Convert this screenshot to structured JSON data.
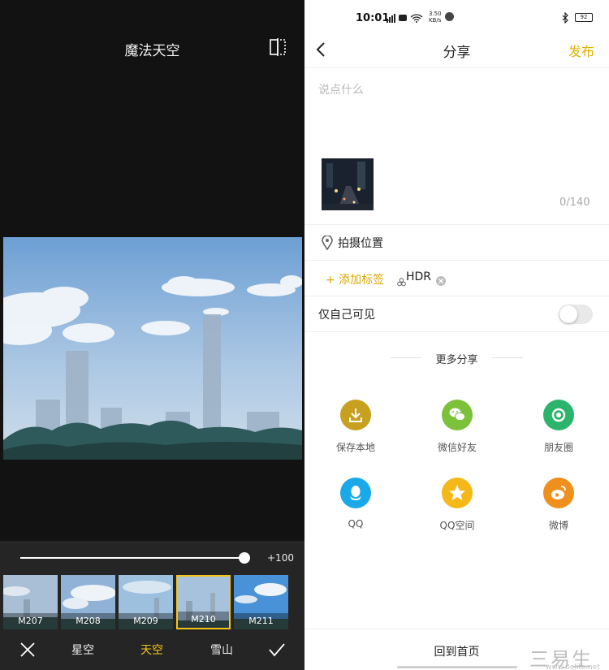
{
  "editor": {
    "title": "魔法天空",
    "slider": {
      "value": 1.0,
      "value_label": "+100"
    },
    "thumbnails": [
      {
        "label": "M207",
        "selected": false
      },
      {
        "label": "M208",
        "selected": false
      },
      {
        "label": "M209",
        "selected": false
      },
      {
        "label": "M210",
        "selected": true
      },
      {
        "label": "M211",
        "selected": false
      }
    ],
    "categories": [
      {
        "label": "星空",
        "active": false
      },
      {
        "label": "天空",
        "active": true
      },
      {
        "label": "雪山",
        "active": false
      }
    ],
    "accent_color": "#f5c518",
    "icons": {
      "compare": "compare-icon",
      "close": "close-icon",
      "confirm": "check-icon"
    }
  },
  "share": {
    "status": {
      "time": "10:01",
      "speed": "3.50",
      "speed_unit": "KB/s",
      "battery": "92"
    },
    "nav": {
      "title": "分享",
      "publish_label": "发布"
    },
    "input": {
      "placeholder": "说点什么",
      "count": "0/140"
    },
    "location_label": "拍摄位置",
    "add_tag_label": "+ 添加标签",
    "tag": "HDR",
    "private_label": "仅自己可见",
    "private_on": false,
    "more_share_title": "更多分享",
    "targets": [
      {
        "label": "保存本地",
        "icon": "download-icon",
        "color": "#c8a020"
      },
      {
        "label": "微信好友",
        "icon": "wechat-icon",
        "color": "#7bc13a"
      },
      {
        "label": "朋友圈",
        "icon": "moments-icon",
        "color": "#2cb36c"
      },
      {
        "label": "QQ",
        "icon": "qq-icon",
        "color": "#1aa9e8"
      },
      {
        "label": "QQ空间",
        "icon": "qzone-icon",
        "color": "#f4b818"
      },
      {
        "label": "微博",
        "icon": "weibo-icon",
        "color": "#ef8f1d"
      }
    ],
    "home_label": "回到首页",
    "publish_color": "#e1b000",
    "watermark": {
      "text": "三易生活",
      "sub": "www.3elife.net"
    }
  }
}
